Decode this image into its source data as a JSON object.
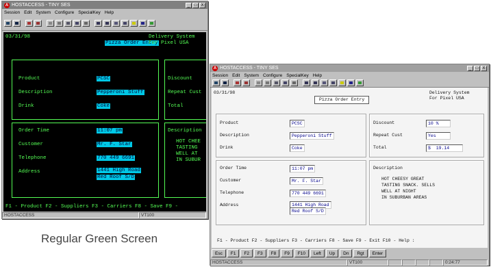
{
  "app": {
    "title": "HOSTACCESS - TINY SES",
    "menu": [
      "Session",
      "Edit",
      "System",
      "Configure",
      "SpecialKey",
      "Help"
    ],
    "window_buttons": [
      "_",
      "□",
      "X"
    ]
  },
  "green": {
    "date": "03/31/98",
    "header_title": "Pizza Order Entry",
    "header_right_1": "Delivery System",
    "header_right_2": "For Pixel USA",
    "labels": {
      "product": "Product",
      "description": "Description",
      "drink": "Drink",
      "discount": "Discount",
      "repeat": "Repeat Cust",
      "total": "Total",
      "order_time": "Order Time",
      "customer": "Customer",
      "telephone": "Telephone",
      "address": "Address",
      "desc2": "Description"
    },
    "values": {
      "product": "PCSC",
      "description": "Pepperoni Stuff",
      "drink": "Coke",
      "order_time": "11:07 pm",
      "customer": "Mr. F. Star",
      "telephone": "770 449 6691",
      "address_1": "1441 High Road",
      "address_2": "Red Roof S/D"
    },
    "desc_lines": [
      "HOT CHEE",
      "TASTING",
      "WELL AT",
      "IN SUBUR"
    ],
    "fkeys_line": "F1 - Product F2 - Suppliers F3 - Carriers F8 - Save F9 -",
    "status_left": "HOSTACCESS",
    "status_mid": "VT100",
    "caption": "Regular Green Screen"
  },
  "gui": {
    "date": "03/31/98",
    "header_title": "Pizza Order Entry",
    "header_right_1": "Delivery System",
    "header_right_2": "For Pixel USA",
    "values": {
      "product": "PCSC",
      "description": "Pepperoni Stuff",
      "drink": "Coke",
      "discount": "10 %",
      "repeat": "Yes",
      "total": "$  19.14",
      "order_time": "11:07 pm",
      "customer": "Mr. F. Star",
      "telephone": "770 449 6691",
      "address_1": "1441 High Road",
      "address_2": "Red Roof S/D"
    },
    "desc_lines": [
      "HOT CHEESY GREAT",
      "TASTING SNACK. SELLS",
      "WELL AT NIGHT",
      "IN SUBURBAN AREAS"
    ],
    "fkeys_line": "F1 - Product F2 - Suppliers F3 - Carriers F8 - Save F9 - Exit F10 - Help :",
    "fkey_buttons": [
      "Esc",
      "F1",
      "F2",
      "F3",
      "F8",
      "F9",
      "F10",
      "Left",
      "Up",
      "Dn",
      "Rgt",
      "Enter"
    ],
    "status_left": "HOSTACCESS",
    "status_mid": "VT100",
    "status_time": "0:24:77"
  },
  "colors": {
    "green_text": "#55ff55",
    "highlight": "#00c8e6",
    "gui_field_text": "#00008b"
  }
}
